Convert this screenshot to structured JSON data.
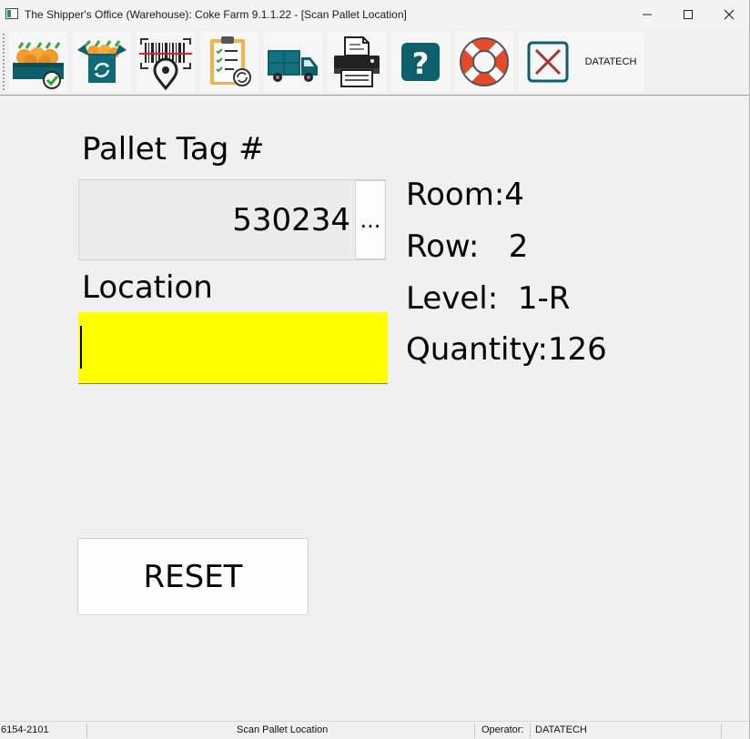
{
  "window": {
    "title": "The Shipper's Office (Warehouse):  Coke Farm 9.1.1.22 - [Scan Pallet Location]"
  },
  "toolbar": {
    "buttons": [
      {
        "name": "receive-produce-icon"
      },
      {
        "name": "repack-box-icon"
      },
      {
        "name": "scan-location-icon"
      },
      {
        "name": "inventory-checklist-icon"
      },
      {
        "name": "shipping-truck-icon"
      },
      {
        "name": "printer-icon"
      },
      {
        "name": "help-icon"
      },
      {
        "name": "support-lifebuoy-icon"
      },
      {
        "name": "exit-icon"
      }
    ],
    "user_label": "DATATECH"
  },
  "form": {
    "pallet_tag_label": "Pallet Tag #",
    "pallet_tag_value": "530234",
    "browse_label": "...",
    "location_label": "Location",
    "location_value": "",
    "location_bg": "#ffff00",
    "room_text": "Room:4",
    "row_text": "Row:   2",
    "level_text": "Level:  1-R",
    "quantity_text": "Quantity:126",
    "reset_label": "RESET"
  },
  "statusbar": {
    "id": "6154-2101",
    "screen": "Scan Pallet Location",
    "operator_label": "Operator:",
    "operator": "DATATECH"
  }
}
